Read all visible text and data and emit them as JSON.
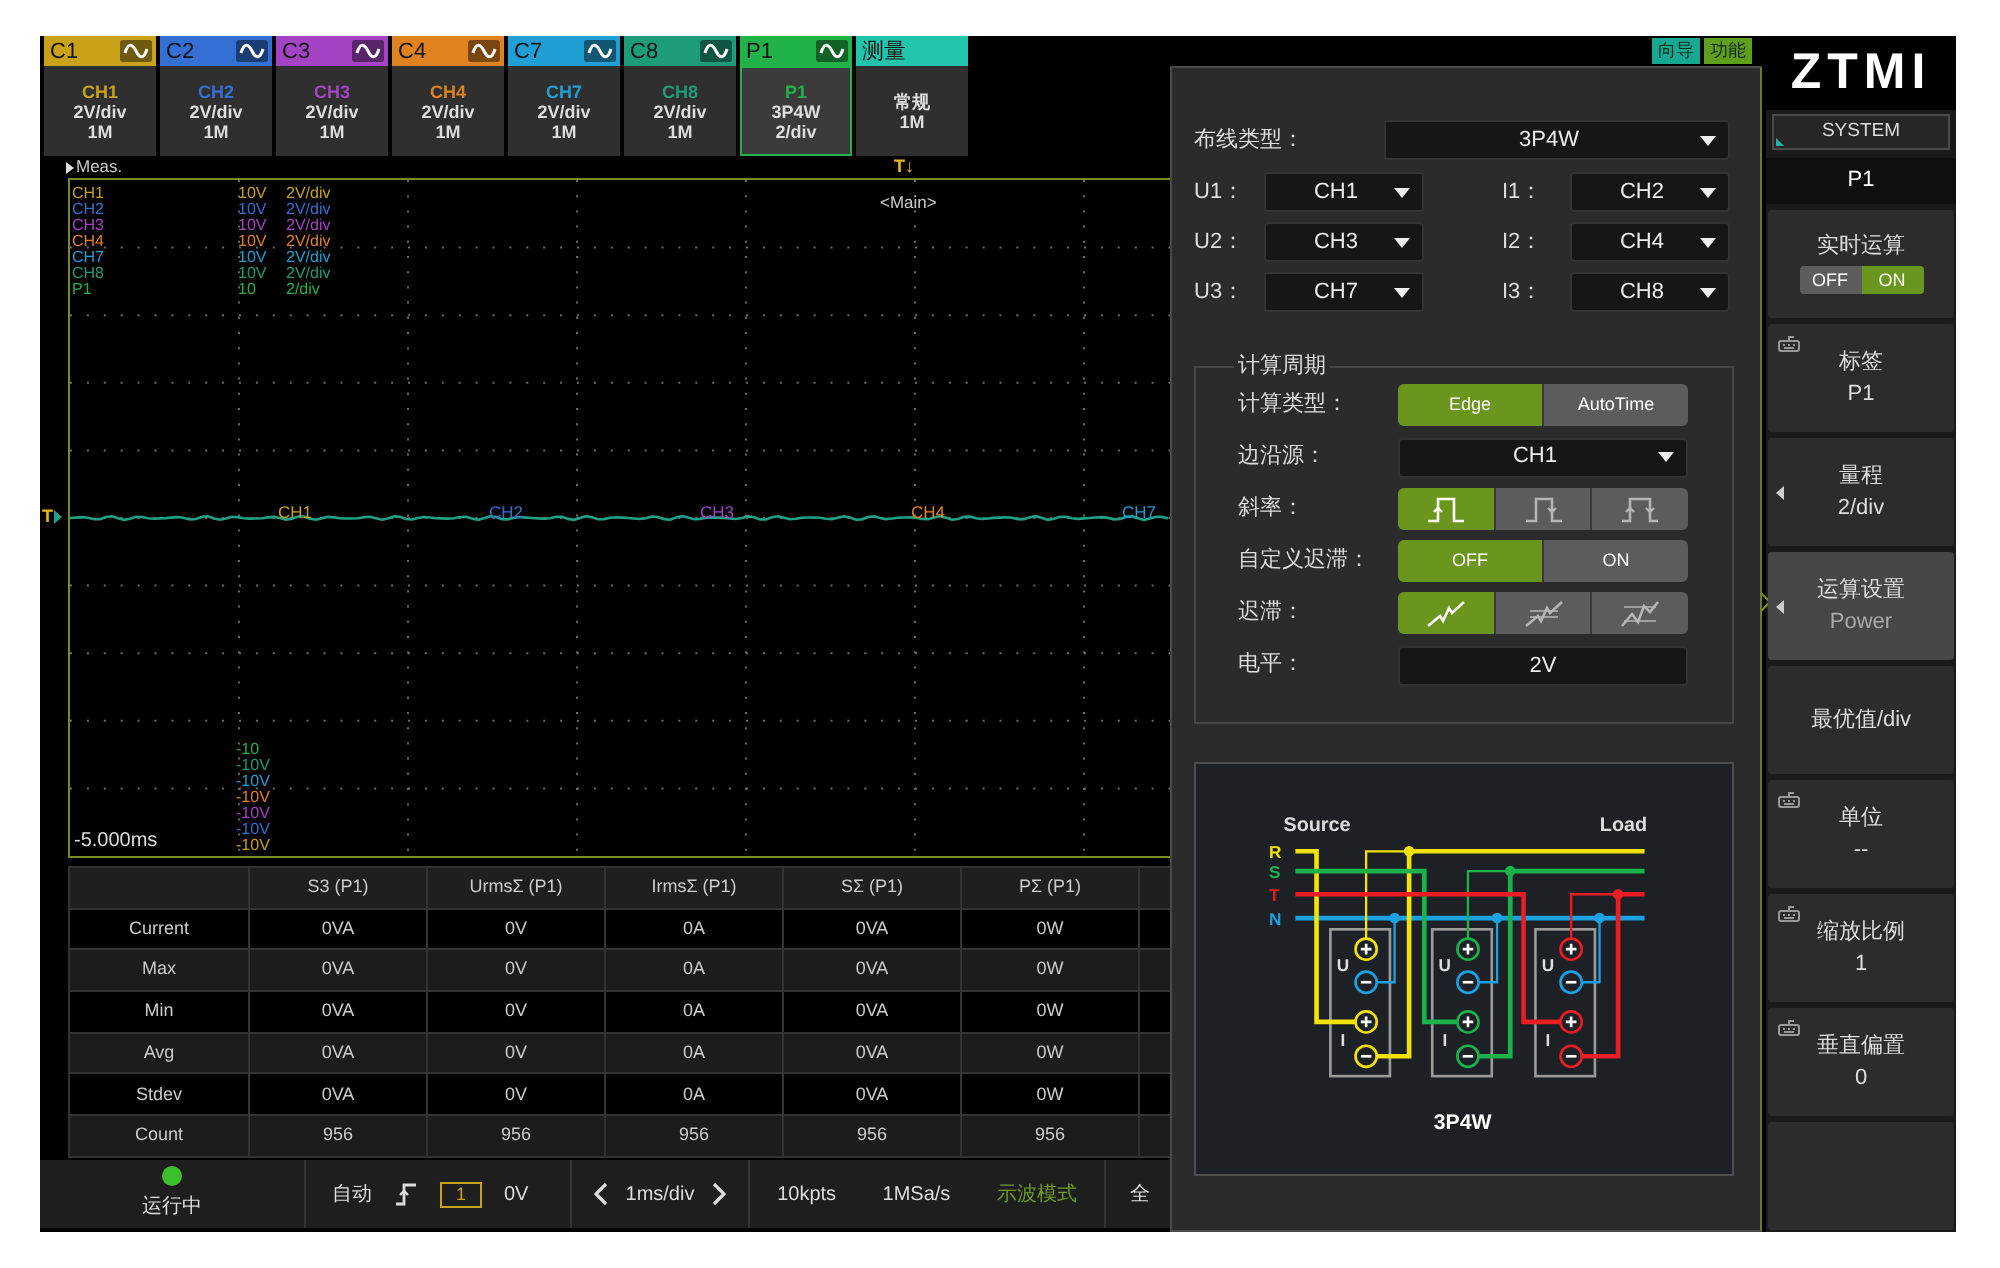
{
  "channel_tabs": [
    {
      "kind": "channel",
      "name": "C1",
      "label": "CH1",
      "lines": [
        "2V/div",
        "1M"
      ],
      "color": "#c9a21a",
      "selected": false
    },
    {
      "kind": "channel",
      "name": "C2",
      "label": "CH2",
      "lines": [
        "2V/div",
        "1M"
      ],
      "color": "#3470d4",
      "selected": false
    },
    {
      "kind": "channel",
      "name": "C3",
      "label": "CH3",
      "lines": [
        "2V/div",
        "1M"
      ],
      "color": "#a443c4",
      "selected": false
    },
    {
      "kind": "channel",
      "name": "C4",
      "label": "CH4",
      "lines": [
        "2V/div",
        "1M"
      ],
      "color": "#e0821f",
      "selected": false
    },
    {
      "kind": "channel",
      "name": "C7",
      "label": "CH7",
      "lines": [
        "2V/div",
        "1M"
      ],
      "color": "#1f9fd4",
      "selected": false
    },
    {
      "kind": "channel",
      "name": "C8",
      "label": "CH8",
      "lines": [
        "2V/div",
        "1M"
      ],
      "color": "#1d9c7a",
      "selected": false
    },
    {
      "kind": "channel",
      "name": "P1",
      "label": "P1",
      "lines": [
        "3P4W",
        "2/div"
      ],
      "color": "#22b24a",
      "selected": true
    },
    {
      "kind": "measure",
      "name": "测量",
      "lines": [
        "常规",
        "1M"
      ],
      "color": "#22c4ac",
      "selected": false
    }
  ],
  "top_buttons": [
    {
      "label": "向导",
      "color": "#17a892"
    },
    {
      "label": "功能",
      "color": "#5f9f1c"
    }
  ],
  "waveform": {
    "title": "Meas.",
    "trigger_marker": "T↓",
    "level_marker": "T",
    "view": "<Main>",
    "time_offset": "-5.000ms",
    "legend": [
      {
        "channel": "CH1",
        "scale": "10V",
        "per_div": "2V/div",
        "color": "#c9a21a"
      },
      {
        "channel": "CH2",
        "scale": "10V",
        "per_div": "2V/div",
        "color": "#3470d4"
      },
      {
        "channel": "CH3",
        "scale": "10V",
        "per_div": "2V/div",
        "color": "#a443c4"
      },
      {
        "channel": "CH4",
        "scale": "10V",
        "per_div": "2V/div",
        "color": "#e0821f"
      },
      {
        "channel": "CH7",
        "scale": "10V",
        "per_div": "2V/div",
        "color": "#1f9fd4"
      },
      {
        "channel": "CH8",
        "scale": "10V",
        "per_div": "2V/div",
        "color": "#1d9c7a"
      },
      {
        "channel": "P1",
        "scale": "10",
        "per_div": "2/div",
        "color": "#22b24a"
      }
    ],
    "trace_labels": [
      {
        "text": "CH1",
        "color": "#c9a21a"
      },
      {
        "text": "CH2",
        "color": "#3470d4"
      },
      {
        "text": "CH3",
        "color": "#a443c4"
      },
      {
        "text": "CH4",
        "color": "#e0821f"
      },
      {
        "text": "CH7",
        "color": "#1f9fd4"
      }
    ],
    "offset_labels": [
      {
        "text": "-10",
        "color": "#22b24a"
      },
      {
        "text": "-10V",
        "color": "#1d9c7a"
      },
      {
        "text": "-10V",
        "color": "#1f9fd4"
      },
      {
        "text": "-10V",
        "color": "#e0821f"
      },
      {
        "text": "-10V",
        "color": "#a443c4"
      },
      {
        "text": "-10V",
        "color": "#3470d4"
      },
      {
        "text": "-10V",
        "color": "#c9a21a"
      }
    ]
  },
  "measurements": {
    "columns": [
      "S3 (P1)",
      "UrmsΣ (P1)",
      "IrmsΣ (P1)",
      "SΣ (P1)",
      "PΣ (P1)"
    ],
    "rows": [
      {
        "label": "Current",
        "cells": [
          "0VA",
          "0V",
          "0A",
          "0VA",
          "0W"
        ]
      },
      {
        "label": "Max",
        "cells": [
          "0VA",
          "0V",
          "0A",
          "0VA",
          "0W"
        ]
      },
      {
        "label": "Min",
        "cells": [
          "0VA",
          "0V",
          "0A",
          "0VA",
          "0W"
        ]
      },
      {
        "label": "Avg",
        "cells": [
          "0VA",
          "0V",
          "0A",
          "0VA",
          "0W"
        ]
      },
      {
        "label": "Stdev",
        "cells": [
          "0VA",
          "0V",
          "0A",
          "0VA",
          "0W"
        ]
      },
      {
        "label": "Count",
        "cells": [
          "956",
          "956",
          "956",
          "956",
          "956"
        ]
      }
    ]
  },
  "status_bar": {
    "run_state": "运行中",
    "running": true,
    "trigger_mode": "自动",
    "trigger_source": "1",
    "trigger_level": "0V",
    "timebase": "1ms/div",
    "memory_depth": "10kpts",
    "sample_rate": "1MSa/s",
    "acquire_mode": "示波模式",
    "next_item": "全"
  },
  "settings_panel": {
    "wiring": {
      "label": "布线类型：",
      "value": "3P4W"
    },
    "channel_map": [
      {
        "label": "U1：",
        "value": "CH1"
      },
      {
        "label": "I1：",
        "value": "CH2"
      },
      {
        "label": "U2：",
        "value": "CH3"
      },
      {
        "label": "I2：",
        "value": "CH4"
      },
      {
        "label": "U3：",
        "value": "CH7"
      },
      {
        "label": "I3：",
        "value": "CH8"
      }
    ],
    "calc_period": {
      "title": "计算周期",
      "rows": [
        {
          "kind": "segmented",
          "label": "计算类型：",
          "options": [
            {
              "text": "Edge",
              "selected": true
            },
            {
              "text": "AutoTime",
              "selected": false
            }
          ]
        },
        {
          "kind": "dropdown",
          "label": "边沿源：",
          "value": "CH1"
        },
        {
          "kind": "slope",
          "label": "斜率：",
          "options": [
            {
              "selected": true
            },
            {
              "selected": false
            },
            {
              "selected": false
            }
          ]
        },
        {
          "kind": "segmented",
          "label": "自定义迟滞：",
          "options": [
            {
              "text": "OFF",
              "selected": true
            },
            {
              "text": "ON",
              "selected": false
            }
          ]
        },
        {
          "kind": "hysteresis",
          "label": "迟滞：",
          "options": [
            {
              "selected": true
            },
            {
              "selected": false
            },
            {
              "selected": false
            }
          ]
        },
        {
          "kind": "field",
          "label": "电平：",
          "value": "2V"
        }
      ]
    },
    "diagram": {
      "source_label": "Source",
      "load_label": "Load",
      "phases": [
        {
          "name": "R",
          "color": "#f2e205"
        },
        {
          "name": "S",
          "color": "#19b24b"
        },
        {
          "name": "T",
          "color": "#ea1c24"
        },
        {
          "name": "N",
          "color": "#1ba1e2"
        }
      ],
      "meters": [
        {
          "voltage_label": "U",
          "current_label": "I"
        },
        {
          "voltage_label": "U",
          "current_label": "I"
        },
        {
          "voltage_label": "U",
          "current_label": "I"
        }
      ],
      "caption": "3P4W"
    }
  },
  "sidebar": {
    "logo": "ZTMI",
    "system_button": "SYSTEM",
    "header": "P1",
    "items": [
      {
        "kind": "toggle",
        "label": "实时运算",
        "options": [
          {
            "text": "OFF",
            "selected": false
          },
          {
            "text": "ON",
            "selected": true
          }
        ],
        "selected": false
      },
      {
        "kind": "keyboard",
        "label": "标签",
        "value": "P1",
        "selected": false
      },
      {
        "kind": "submenu",
        "label": "量程",
        "value": "2/div",
        "selected": false
      },
      {
        "kind": "submenu",
        "label": "运算设置",
        "value": "Power",
        "selected": true
      },
      {
        "kind": "plain",
        "label": "最优值/div",
        "selected": false
      },
      {
        "kind": "keyboard",
        "label": "单位",
        "value": "--",
        "selected": false
      },
      {
        "kind": "keyboard",
        "label": "缩放比例",
        "value": "1",
        "selected": false
      },
      {
        "kind": "keyboard",
        "label": "垂直偏置",
        "value": "0",
        "selected": false
      },
      {
        "kind": "blank",
        "selected": false
      }
    ]
  }
}
